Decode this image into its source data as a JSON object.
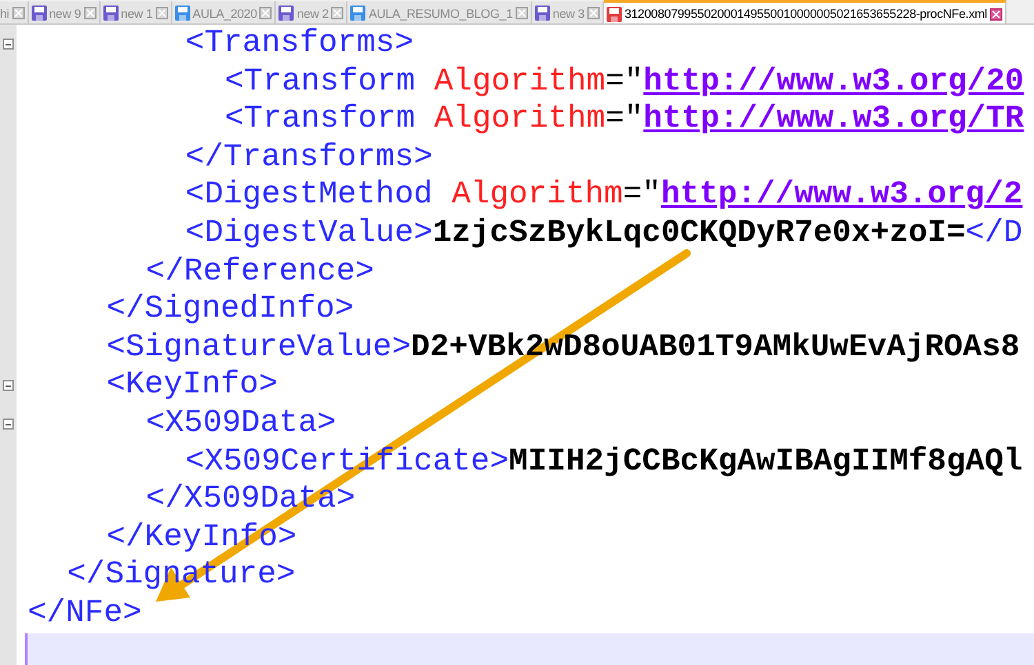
{
  "tabs": [
    {
      "label": "hi",
      "selected": false
    },
    {
      "label": "new 9",
      "selected": false,
      "color": "#6a5acd"
    },
    {
      "label": "new 1",
      "selected": false,
      "color": "#6a5acd"
    },
    {
      "label": "AULA_2020",
      "selected": false,
      "color": "#3a8ee6"
    },
    {
      "label": "new 2",
      "selected": false,
      "color": "#6a5acd"
    },
    {
      "label": "AULA_RESUMO_BLOG_1",
      "selected": false,
      "color": "#3a8ee6"
    },
    {
      "label": "new 3",
      "selected": false,
      "color": "#6a5acd"
    },
    {
      "label": "31200807995502000149550010000005021653655228-procNFe.xml",
      "selected": true,
      "color": "#e03c3c"
    }
  ],
  "editor": {
    "tree": [
      {
        "close": [
          {
            "kind": "tag",
            "text": "</NFe>"
          }
        ],
        "children": [
          {
            "close": [
              {
                "kind": "tag",
                "text": "</Signature>"
              }
            ],
            "children": [
              {
                "close": [
                  {
                    "kind": "tag",
                    "text": "</SignedInfo>"
                  }
                ],
                "children": [
                  {
                    "close": [
                      {
                        "kind": "tag",
                        "text": "</Reference>"
                      }
                    ],
                    "children": [
                      {
                        "open": [
                          {
                            "kind": "tag",
                            "text": "<Transforms>"
                          }
                        ],
                        "close": [
                          {
                            "kind": "tag",
                            "text": "</Transforms>"
                          }
                        ],
                        "children": [
                          {
                            "open": [
                              {
                                "kind": "tag",
                                "text": "<Transform"
                              },
                              {
                                "kind": "attr",
                                "text": " Algorithm"
                              },
                              {
                                "kind": "punct",
                                "text": "=\""
                              },
                              {
                                "kind": "value",
                                "text": "http://www.w3.org/20"
                              }
                            ]
                          },
                          {
                            "open": [
                              {
                                "kind": "tag",
                                "text": "<Transform"
                              },
                              {
                                "kind": "attr",
                                "text": " Algorithm"
                              },
                              {
                                "kind": "punct",
                                "text": "=\""
                              },
                              {
                                "kind": "value",
                                "text": "http://www.w3.org/TR"
                              }
                            ]
                          }
                        ]
                      },
                      {
                        "open": [
                          {
                            "kind": "tag",
                            "text": "<DigestMethod"
                          },
                          {
                            "kind": "attr",
                            "text": " Algorithm"
                          },
                          {
                            "kind": "punct",
                            "text": "=\""
                          },
                          {
                            "kind": "value",
                            "text": "http://www.w3.org/2"
                          }
                        ]
                      },
                      {
                        "open": [
                          {
                            "kind": "tag",
                            "text": "<DigestValue>"
                          },
                          {
                            "kind": "text",
                            "text": "1zjcSzBykLqc0CKQDyR7e0x+zoI="
                          },
                          {
                            "kind": "tag",
                            "text": "</D"
                          }
                        ]
                      }
                    ]
                  }
                ]
              },
              {
                "open": [
                  {
                    "kind": "tag",
                    "text": "<SignatureValue>"
                  },
                  {
                    "kind": "text",
                    "text": "D2+VBk2wD8oUAB01T9AMkUwEvAjROAs8"
                  }
                ]
              },
              {
                "open": [
                  {
                    "kind": "tag",
                    "text": "<KeyInfo>"
                  }
                ],
                "close": [
                  {
                    "kind": "tag",
                    "text": "</KeyInfo>"
                  }
                ],
                "children": [
                  {
                    "open": [
                      {
                        "kind": "tag",
                        "text": "<X509Data>"
                      }
                    ],
                    "close": [
                      {
                        "kind": "tag",
                        "text": "</X509Data>"
                      }
                    ],
                    "children": [
                      {
                        "open": [
                          {
                            "kind": "tag",
                            "text": "<X509Certificate>"
                          },
                          {
                            "kind": "text",
                            "text": "MIIH2jCCBcKgAwIBAgIIMf8gAQl"
                          }
                        ]
                      }
                    ]
                  }
                ]
              }
            ]
          }
        ]
      }
    ]
  }
}
